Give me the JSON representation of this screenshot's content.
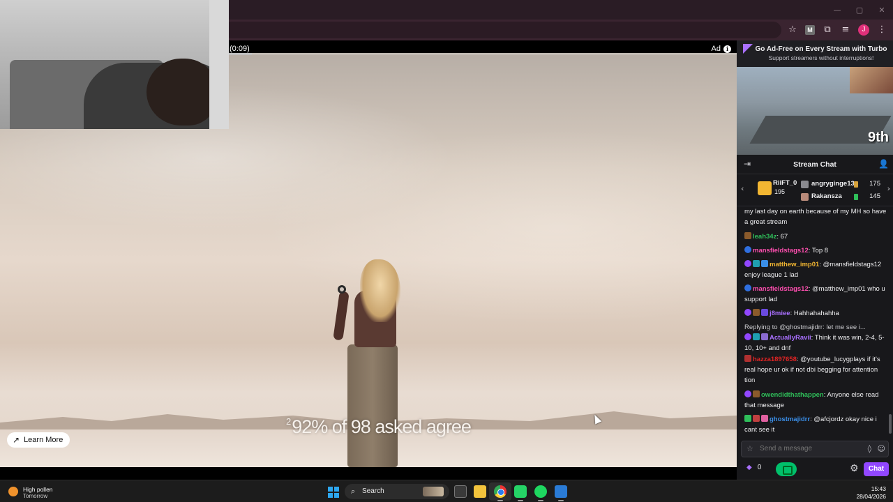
{
  "browser": {
    "window_controls": [
      "—",
      "▢",
      "✕"
    ],
    "toolbar_icons": [
      "star-icon",
      "extension-icon",
      "media-icon",
      "menu-icon"
    ],
    "profile_letter": "J",
    "extension_letter": "M"
  },
  "video": {
    "ad_timer": "(0:09)",
    "ad_label": "Ad",
    "ad_progress_fraction": 0.045,
    "caption_superscript": "2",
    "caption": "92% of 98 asked agree",
    "learn_more": "Learn More"
  },
  "sidebar": {
    "turbo_title": "Go Ad-Free on Every Stream with Turbo",
    "turbo_subtitle": "Support streamers without interruptions!",
    "preview_rank": "9th",
    "chat_title": "Stream Chat",
    "leaderboard": {
      "first": {
        "name": "RiiFT_0",
        "count": "195"
      },
      "rows": [
        {
          "name": "angryginge13",
          "count": "175",
          "color": "#d6a23c"
        },
        {
          "name": "Rakansza",
          "count": "145",
          "color": "#2fbf5a"
        }
      ]
    },
    "messages": [
      {
        "user": "",
        "user_color": "#efeff1",
        "text": "my last day on earth because of my MH so have a great stream",
        "badges": []
      },
      {
        "user": "leah34z",
        "user_color": "#2fbf5a",
        "text": "67",
        "badges": [
          "#8a5a2b"
        ]
      },
      {
        "user": "mansfieldstags12",
        "user_color": "#ff4fb0",
        "text": "Top 8",
        "badges": [
          "#2f6fe0"
        ]
      },
      {
        "user": "matthew_imp01",
        "user_color": "#f2b632",
        "text": "@mansfieldstags12 enjoy league 1 lad",
        "badges": [
          "#9147ff",
          "#1fa0b0",
          "#3a8ee8"
        ]
      },
      {
        "user": "mansfieldstags12",
        "user_color": "#ff4fb0",
        "text": "@matthew_imp01 who u support lad",
        "badges": [
          "#2f6fe0"
        ]
      },
      {
        "user": "j8miee",
        "user_color": "#a970ff",
        "text": "Hahhahahahha",
        "badges": [
          "#9147ff",
          "#8a5a2b",
          "#6a4ae0"
        ]
      },
      {
        "user": "ActuallyRavii",
        "user_color": "#a970ff",
        "text": "Think it was win, 2-4, 5-10, 10+ and dnf",
        "reply": "Replying to @ghostmajidrr: let me see i...",
        "badges": [
          "#9147ff",
          "#1fa0b0",
          "#8a6ad0"
        ]
      },
      {
        "user": "hazza1897658",
        "user_color": "#e02424",
        "text": "@youtube_lucygplays if it's real hope ur ok if not dbi begging for attention tion",
        "badges": [
          "#b03030"
        ]
      },
      {
        "user": "owendidthathappen",
        "user_color": "#2fbf5a",
        "text": "Anyone else read that message",
        "badges": [
          "#9147ff",
          "#8a5a2b"
        ]
      },
      {
        "user": "ghostmajidrr",
        "user_color": "#3a8ee8",
        "text": "@afcjordz okay nice i cant see it",
        "badges": [
          "#2fbf5a",
          "#c04040",
          "#e060a0"
        ]
      }
    ],
    "input_placeholder": "Send a message",
    "points": "0",
    "chat_button": "Chat"
  },
  "taskbar": {
    "weather_title": "High pollen",
    "weather_sub": "Tomorrow",
    "search_label": "Search",
    "apps": [
      "task-view-icon",
      "file-explorer-icon",
      "chrome-icon",
      "whatsapp-icon",
      "spotify-icon",
      "vscode-icon"
    ],
    "time": "15:43",
    "date": "28/04/2026"
  }
}
